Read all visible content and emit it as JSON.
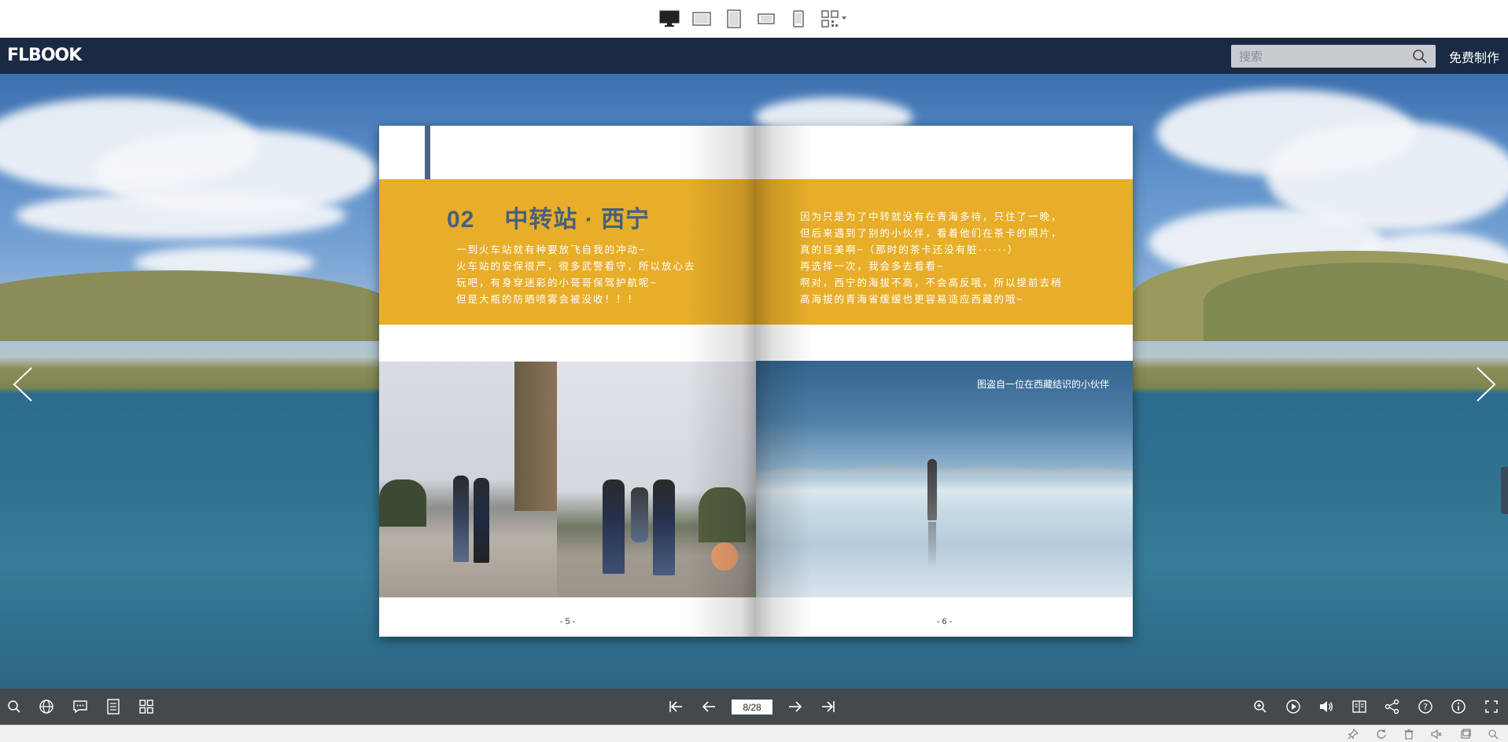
{
  "app": {
    "logo": "FLBOOK",
    "search": {
      "placeholder": "搜索"
    },
    "make_label": "免费制作"
  },
  "device_modes": [
    {
      "name": "desktop",
      "active": true
    },
    {
      "name": "tablet-landscape",
      "active": false
    },
    {
      "name": "tablet-portrait",
      "active": false
    },
    {
      "name": "phone-landscape",
      "active": false
    },
    {
      "name": "phone-portrait",
      "active": false
    },
    {
      "name": "qr-code",
      "active": false
    }
  ],
  "book": {
    "left_page": {
      "chapter_number": "02",
      "chapter_title": "中转站 · 西宁",
      "lines": [
        "一到火车站就有种要放飞自我的冲动~",
        "火车站的安保很严，很多武警看守，所以放心去",
        "玩吧，有身穿迷彩的小哥哥保驾护航呢~",
        "但是大瓶的防晒喷雾会被没收！！！"
      ],
      "page_number": "- 5 -"
    },
    "right_page": {
      "lines": [
        "因为只是为了中转就没有在青海多待，只住了一晚，",
        "但后来遇到了别的小伙伴，看着他们在茶卡的照片，",
        "真的巨美啊~（那时的茶卡还没有脏······）",
        "再选择一次，我会多去看看~",
        "啊对，西宁的海拔不高，不会高反哦，所以提前去稍",
        "高海拔的青海省缓缓也更容易适应西藏的哦~"
      ],
      "caption": "图盗自一位在西藏结识的小伙伴",
      "page_number": "- 6 -"
    }
  },
  "toolbar": {
    "left_icons": [
      "search-icon",
      "globe-icon",
      "comment-icon",
      "notes-icon",
      "thumbnails-icon"
    ],
    "center_icons": [
      "first-page-icon",
      "prev-page-icon",
      "next-page-icon",
      "last-page-icon"
    ],
    "page_indicator": "8/28",
    "right_icons": [
      "zoom-in-icon",
      "autoplay-icon",
      "sound-icon",
      "bookmark-icon",
      "share-icon",
      "help-icon",
      "info-icon",
      "fullscreen-icon"
    ]
  },
  "statusbar_icons": [
    "pin-icon",
    "refresh-icon",
    "trash-icon",
    "mute-icon",
    "window-icon",
    "zoom-icon"
  ],
  "colors": {
    "header_bg": "#1a2a44",
    "accent_yellow": "#e8ae2a",
    "title_blue": "#46607f",
    "toolbar_bg": "#343a3e"
  }
}
